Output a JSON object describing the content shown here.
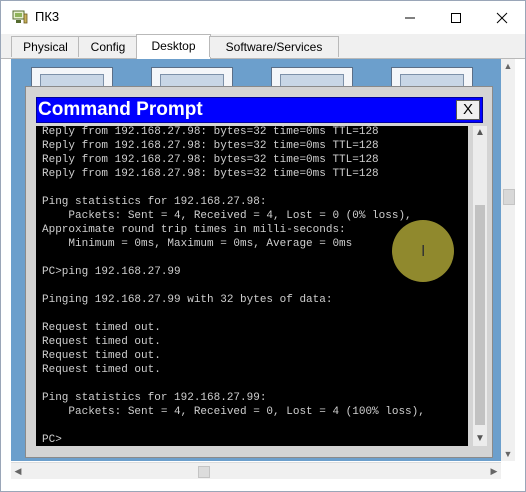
{
  "window": {
    "title": "ПК3"
  },
  "tabs": [
    {
      "label": "Physical",
      "active": false
    },
    {
      "label": "Config",
      "active": false
    },
    {
      "label": "Desktop",
      "active": true
    },
    {
      "label": "Software/Services",
      "active": false
    }
  ],
  "command_prompt": {
    "title": "Command Prompt",
    "close_label": "X",
    "lines": [
      "Reply from 192.168.27.98: bytes=32 time=0ms TTL=128",
      "Reply from 192.168.27.98: bytes=32 time=0ms TTL=128",
      "Reply from 192.168.27.98: bytes=32 time=0ms TTL=128",
      "Reply from 192.168.27.98: bytes=32 time=0ms TTL=128",
      "",
      "Ping statistics for 192.168.27.98:",
      "    Packets: Sent = 4, Received = 4, Lost = 0 (0% loss),",
      "Approximate round trip times in milli-seconds:",
      "    Minimum = 0ms, Maximum = 0ms, Average = 0ms",
      "",
      "PC>ping 192.168.27.99",
      "",
      "Pinging 192.168.27.99 with 32 bytes of data:",
      "",
      "Request timed out.",
      "Request timed out.",
      "Request timed out.",
      "Request timed out.",
      "",
      "Ping statistics for 192.168.27.99:",
      "    Packets: Sent = 4, Received = 0, Lost = 4 (100% loss),",
      "",
      "PC>"
    ]
  },
  "colors": {
    "desktop_bg": "#6c9fcc",
    "cmd_title_bg": "#0000ff",
    "console_bg": "#000000",
    "console_text": "#cfcfcf",
    "cursor_halo": "#b8b03a"
  },
  "icons": [
    "app-icon",
    "minimize-icon",
    "maximize-icon",
    "close-icon",
    "text-cursor-icon"
  ]
}
